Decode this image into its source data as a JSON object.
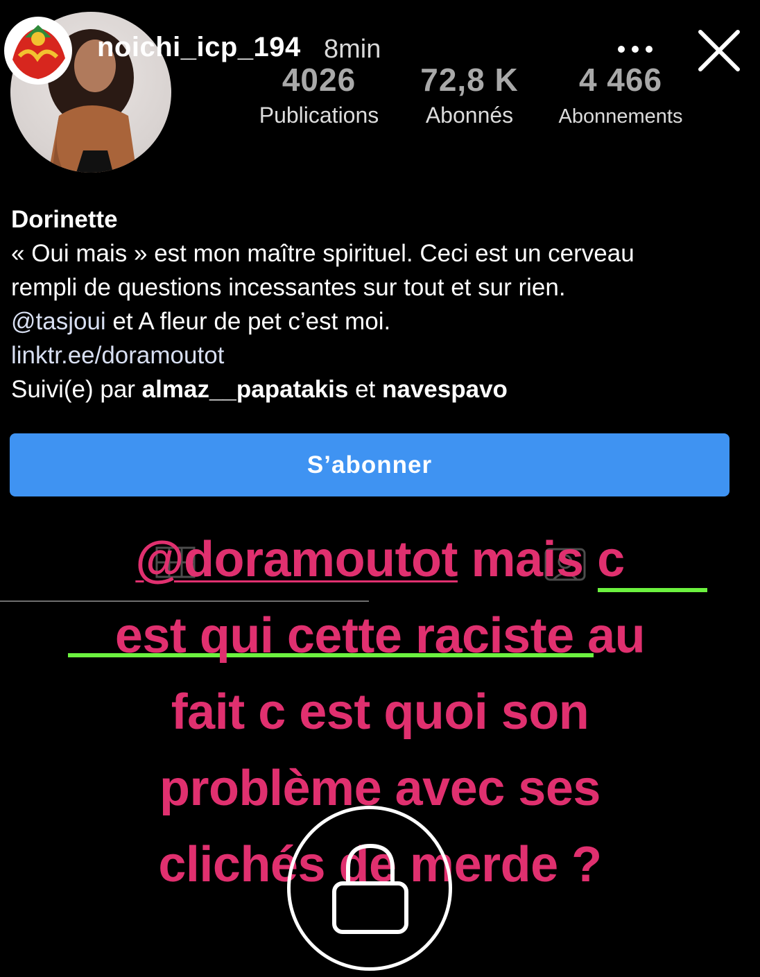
{
  "story": {
    "username": "noichi_icp_194",
    "time": "8min"
  },
  "profile": {
    "stats": [
      {
        "value": "4026",
        "label": "Publications"
      },
      {
        "value": "72,8 K",
        "label": "Abonnés"
      },
      {
        "value": "4 466",
        "label": "Abonnements"
      }
    ],
    "name": "Dorinette",
    "bio_line1": "« Oui mais » est mon maître spirituel. Ceci est un cerveau",
    "bio_line2": "rempli de questions incessantes sur tout et sur rien.",
    "bio_mention": "@tasjoui",
    "bio_line3_rest": " et A fleur de pet c’est moi.",
    "link": "linktr.ee/doramoutot",
    "followed_prefix": "Suivi(e) par ",
    "followed_user1": "almaz__papatakis",
    "followed_and": " et ",
    "followed_user2": "navespavo",
    "follow_button": "S’abonner"
  },
  "caption": {
    "mention": "@doramoutot",
    "line1_rest": "  mais c",
    "line2": "est qui cette raciste au",
    "line3": "fait c est quoi son",
    "line4": "problème avec ses",
    "line5": "clichés de merde ?"
  },
  "colors": {
    "caption": "#e0306f",
    "button": "#3f93f2",
    "highlight": "#6cf23f"
  }
}
